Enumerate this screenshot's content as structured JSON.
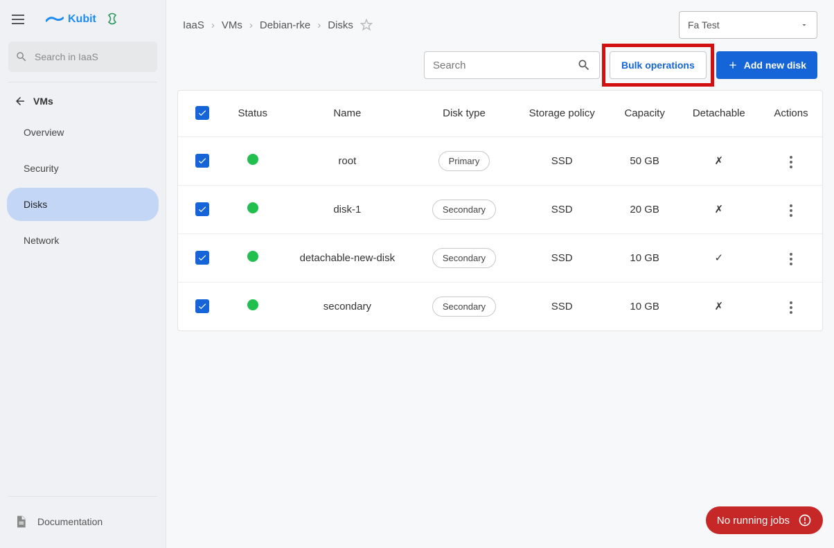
{
  "sidebar": {
    "brand": "Kubit",
    "search_placeholder": "Search in IaaS",
    "back_label": "VMs",
    "items": [
      {
        "label": "Overview"
      },
      {
        "label": "Security"
      },
      {
        "label": "Disks"
      },
      {
        "label": "Network"
      }
    ],
    "documentation_label": "Documentation"
  },
  "breadcrumbs": [
    "IaaS",
    "VMs",
    "Debian-rke",
    "Disks"
  ],
  "project_selector": {
    "selected": "Fa Test"
  },
  "toolbar": {
    "search_placeholder": "Search",
    "bulk_label": "Bulk operations",
    "add_label": "Add new disk"
  },
  "table": {
    "columns": [
      "Status",
      "Name",
      "Disk type",
      "Storage policy",
      "Capacity",
      "Detachable",
      "Actions"
    ],
    "rows": [
      {
        "checked": true,
        "status": "ok",
        "name": "root",
        "type": "Primary",
        "policy": "SSD",
        "capacity": "50 GB",
        "detachable": "✗"
      },
      {
        "checked": true,
        "status": "ok",
        "name": "disk-1",
        "type": "Secondary",
        "policy": "SSD",
        "capacity": "20 GB",
        "detachable": "✗"
      },
      {
        "checked": true,
        "status": "ok",
        "name": "detachable-new-disk",
        "type": "Secondary",
        "policy": "SSD",
        "capacity": "10 GB",
        "detachable": "✓"
      },
      {
        "checked": true,
        "status": "ok",
        "name": "secondary",
        "type": "Secondary",
        "policy": "SSD",
        "capacity": "10 GB",
        "detachable": "✗"
      }
    ]
  },
  "jobs": {
    "label": "No running jobs"
  }
}
